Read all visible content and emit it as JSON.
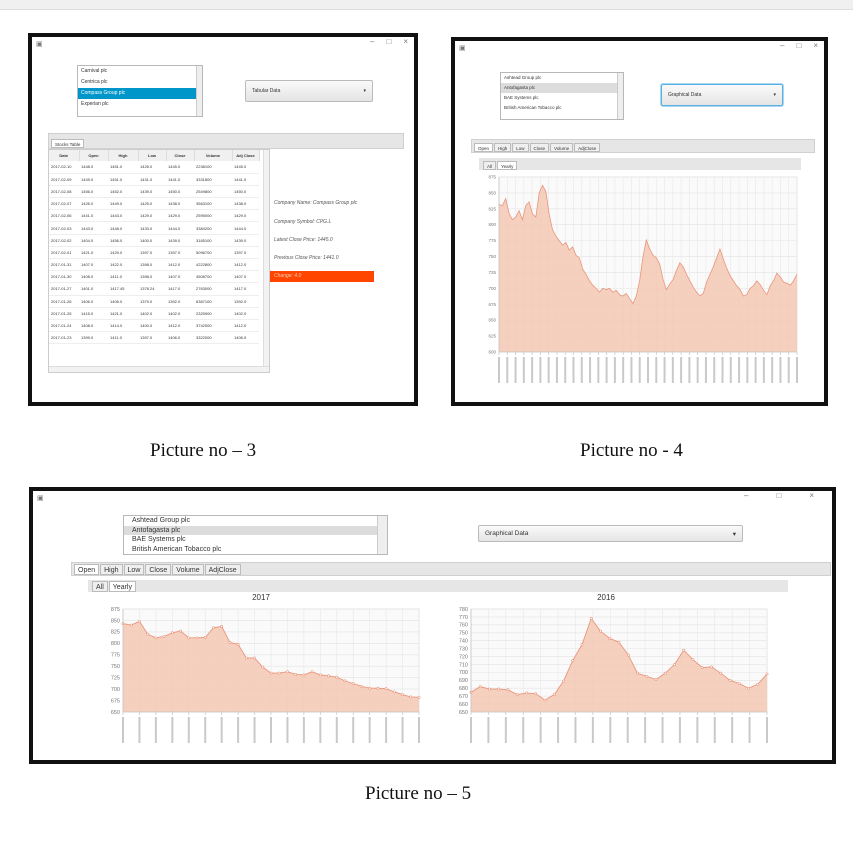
{
  "captions": [
    "Picture no – 3",
    "Picture no - 4",
    "Picture no – 5"
  ],
  "icons": {
    "app": "app-icon",
    "minimize": "minimize-icon",
    "maximize": "maximize-icon",
    "close": "close-icon",
    "dropdown": "chevron-down-icon"
  },
  "window_controls": {
    "minimize": "–",
    "maximize": "□",
    "close": "×"
  },
  "colors": {
    "selection": "#0096c9",
    "change_badge": "#ff4500",
    "area_fill": "#f5c8b3",
    "area_line": "#e8967d"
  },
  "pic3": {
    "companies": [
      "Carnival plc",
      "Centrica plc",
      "Compass Group plc",
      "Experian plc"
    ],
    "selected_company_index": 2,
    "view_select": "Tabular Data",
    "table_tab": "Stocks Table",
    "columns": [
      "Date",
      "Open",
      "High",
      "Low",
      "Close",
      "Volume",
      "Adj Close"
    ],
    "rows": [
      [
        "2017-02-10",
        "1448.0",
        "1451.0",
        "1426.0",
        "1445.0",
        "2238100",
        "1445.0"
      ],
      [
        "2017-02-09",
        "1449.0",
        "1451.0",
        "1431.0",
        "1441.0",
        "3331800",
        "1441.0"
      ],
      [
        "2017-02-08",
        "1456.0",
        "1452.0",
        "1439.0",
        "1450.0",
        "2549800",
        "1450.0"
      ],
      [
        "2017-02-07",
        "1426.0",
        "1449.0",
        "1425.0",
        "1438.0",
        "3563100",
        "1438.0"
      ],
      [
        "2017-02-06",
        "1441.0",
        "1443.0",
        "1429.0",
        "1429.0",
        "2595000",
        "1429.0"
      ],
      [
        "2017-02-03",
        "1443.0",
        "1448.0",
        "1433.0",
        "1444.0",
        "3384200",
        "1444.0"
      ],
      [
        "2017-02-02",
        "1404.0",
        "1456.0",
        "1400.0",
        "1439.0",
        "3165100",
        "1439.0"
      ],
      [
        "2017-02-01",
        "1421.0",
        "1429.0",
        "1397.0",
        "1397.0",
        "5096700",
        "1397.0"
      ],
      [
        "2017-01-31",
        "1407.0",
        "1422.0",
        "1398.0",
        "1412.0",
        "4222800",
        "1412.0"
      ],
      [
        "2017-01-30",
        "1408.0",
        "1411.0",
        "1398.0",
        "1407.0",
        "4508700",
        "1407.0"
      ],
      [
        "2017-01-27",
        "1401.0",
        "1417.45",
        "1378.24",
        "1417.0",
        "2763000",
        "1417.0"
      ],
      [
        "2017-01-26",
        "1406.0",
        "1406.0",
        "1379.0",
        "1392.0",
        "6387100",
        "1392.0"
      ],
      [
        "2017-01-25",
        "1415.0",
        "1421.0",
        "1402.0",
        "1402.0",
        "2325900",
        "1402.0"
      ],
      [
        "2017-01-24",
        "1408.0",
        "1414.0",
        "1400.0",
        "1412.0",
        "3742000",
        "1412.0"
      ],
      [
        "2017-01-23",
        "1399.0",
        "1411.0",
        "1397.0",
        "1406.0",
        "3322000",
        "1406.0"
      ]
    ],
    "info": {
      "company_name": "Company Name: Compass Group plc",
      "company_symbol": "Company Symbol: CPG.L",
      "latest_close": "Latest Close Price: 1445.0",
      "previous_close": "Previous Close Price: 1441.0",
      "change": "Change: 4.0"
    }
  },
  "pic4": {
    "companies": [
      "Ashtead Group plc",
      "Antofagasta plc",
      "BAE Systems plc",
      "British American Tobacco plc"
    ],
    "selected_company_index": 1,
    "view_select": "Graphical Data",
    "tabs": [
      "Open",
      "High",
      "Low",
      "Close",
      "Volume",
      "AdjClose"
    ],
    "subtabs": [
      "All",
      "Yearly"
    ]
  },
  "pic5": {
    "companies": [
      "Ashtead Group plc",
      "Antofagasta plc",
      "BAE Systems plc",
      "British American Tobacco plc"
    ],
    "selected_company_index": 1,
    "view_select": "Graphical Data",
    "tabs": [
      "Open",
      "High",
      "Low",
      "Close",
      "Volume",
      "AdjClose"
    ],
    "subtabs": [
      "All",
      "Yearly"
    ]
  },
  "chart_data": [
    {
      "type": "area",
      "title": "",
      "yticks": [
        875,
        850,
        825,
        800,
        775,
        750,
        725,
        700,
        675,
        650,
        625,
        600
      ],
      "ylim": [
        600,
        875
      ],
      "values": [
        832,
        830,
        841,
        818,
        808,
        812,
        822,
        808,
        830,
        836,
        817,
        812,
        850,
        862,
        852,
        816,
        792,
        782,
        775,
        768,
        772,
        760,
        765,
        752,
        748,
        730,
        722,
        712,
        705,
        700,
        694,
        700,
        698,
        700,
        694,
        697,
        690,
        688,
        692,
        684,
        676,
        688,
        712,
        750,
        776,
        762,
        752,
        748,
        738,
        714,
        698,
        707,
        714,
        728,
        740,
        734,
        722,
        712,
        702,
        694,
        688,
        692,
        710,
        722,
        734,
        748,
        762,
        746,
        732,
        720,
        712,
        704,
        698,
        688,
        690,
        700,
        704,
        712,
        706,
        697,
        690,
        704,
        712,
        724,
        718,
        710,
        708,
        705,
        712,
        722
      ]
    },
    {
      "type": "area",
      "title": "2017",
      "yticks": [
        875,
        850,
        825,
        800,
        775,
        750,
        725,
        700,
        675,
        650
      ],
      "ylim": [
        650,
        875
      ],
      "values": [
        843,
        840,
        848,
        820,
        812,
        815,
        823,
        827,
        812,
        812,
        813,
        834,
        837,
        802,
        798,
        768,
        768,
        748,
        735,
        735,
        738,
        732,
        731,
        738,
        731,
        729,
        726,
        718,
        712,
        706,
        702,
        702,
        701,
        694,
        688,
        683,
        682
      ]
    },
    {
      "type": "area",
      "title": "2016",
      "yticks": [
        780,
        770,
        760,
        750,
        740,
        730,
        720,
        710,
        700,
        690,
        680,
        670,
        660,
        650
      ],
      "ylim": [
        650,
        780
      ],
      "values": [
        675,
        682,
        679,
        679,
        678,
        672,
        674,
        673,
        665,
        672,
        689,
        715,
        735,
        768,
        752,
        743,
        738,
        722,
        699,
        695,
        691,
        699,
        710,
        728,
        716,
        706,
        707,
        699,
        690,
        686,
        680,
        685,
        698
      ]
    }
  ]
}
